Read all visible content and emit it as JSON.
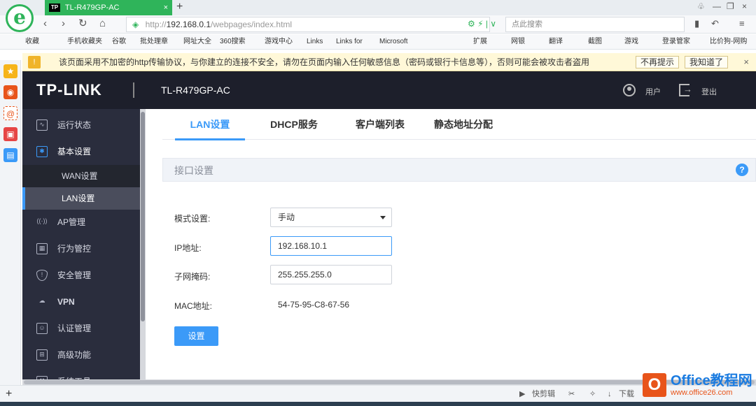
{
  "browser": {
    "logo_glyph": "e",
    "tab_title": "TL-R479GP-AC",
    "tab_favicon": "TP",
    "new_tab": "+",
    "url_scheme": "http://",
    "url_host": "192.168.0.1",
    "url_path": "/webpages/index.html",
    "search_placeholder": "点此搜索",
    "close_glyph": "×"
  },
  "bookmarks": [
    "收藏",
    "手机收藏夹",
    "谷歌",
    "批处理章",
    "网址大全",
    "360搜索",
    "游戏中心",
    "Links",
    "Links for",
    "Microsoft",
    "扩展",
    "网银",
    "翻译",
    "截图",
    "游戏",
    "登录管家",
    "比价狗-网购"
  ],
  "warning": {
    "text": "该页面采用不加密的http传输协议，与你建立的连接不安全，请勿在页面内输入任何敏感信息（密码或银行卡信息等），否则可能会被攻击者盗用",
    "dont_remind": "不再提示",
    "got_it": "我知道了"
  },
  "router": {
    "brand": "TP-LINK",
    "model": "TL-R479GP-AC",
    "user_label": "用户",
    "logout_label": "登出",
    "sidebar": {
      "status": "运行状态",
      "basic": "基本设置",
      "wan": "WAN设置",
      "lan": "LAN设置",
      "ap": "AP管理",
      "behavior": "行为管控",
      "security": "安全管理",
      "vpn": "VPN",
      "auth": "认证管理",
      "advanced": "高级功能",
      "tools": "系统工具"
    },
    "tabs": [
      "LAN设置",
      "DHCP服务",
      "客户端列表",
      "静态地址分配"
    ],
    "section_title": "接口设置",
    "help_glyph": "?",
    "form": {
      "mode_label": "模式设置:",
      "mode_value": "手动",
      "ip_label": "IP地址:",
      "ip_value": "192.168.10.1",
      "mask_label": "子网掩码:",
      "mask_value": "255.255.255.0",
      "mac_label": "MAC地址:",
      "mac_value": "54-75-95-C8-67-56",
      "submit": "设置"
    }
  },
  "statusbar": {
    "quick_clip": "快剪辑",
    "download": "下载"
  },
  "watermark": {
    "brand": "Office教程网",
    "url": "www.office26.com"
  },
  "colors": {
    "accent": "#3b9af8",
    "header": "#1d1f2b",
    "sidebar": "#2a2d3d",
    "browser_green": "#2fb45a"
  }
}
